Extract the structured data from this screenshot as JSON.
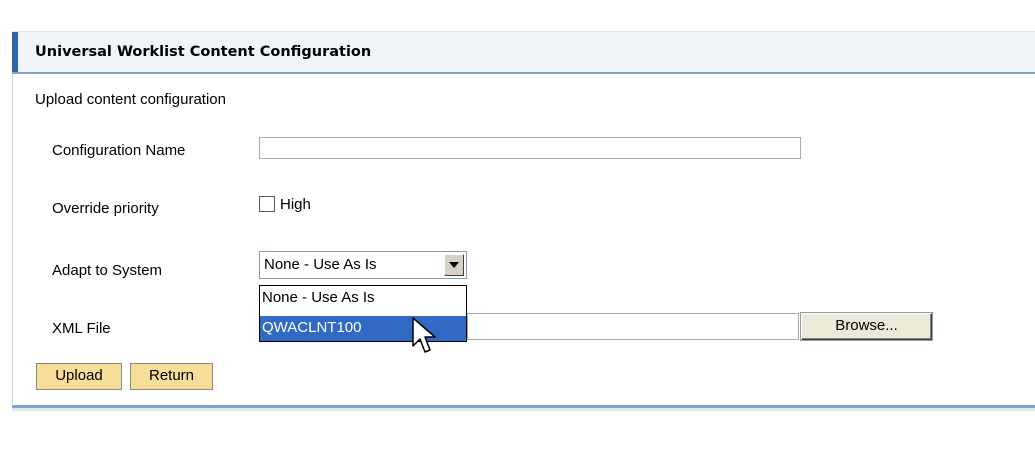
{
  "panel": {
    "title": "Universal Worklist Content Configuration"
  },
  "form": {
    "section_heading": "Upload content configuration",
    "configuration_name": {
      "label": "Configuration Name",
      "value": ""
    },
    "override_priority": {
      "label": "Override priority",
      "checkbox_label": "High",
      "checked": false
    },
    "adapt_to_system": {
      "label": "Adapt to System",
      "selected": "None - Use As Is",
      "options": [
        "None - Use As Is",
        "QWACLNT100"
      ],
      "highlighted_option": "QWACLNT100",
      "dropdown_open": true
    },
    "xml_file": {
      "label": "XML File",
      "value": "",
      "browse_label": "Browse..."
    }
  },
  "actions": {
    "upload_label": "Upload",
    "return_label": "Return"
  },
  "colors": {
    "accent": "#2e65a4",
    "button_bg": "#f6dd9a",
    "selection": "#316ac5"
  },
  "icons": {
    "cursor": "arrow-cursor-icon",
    "dropdown": "chevron-down-icon"
  }
}
